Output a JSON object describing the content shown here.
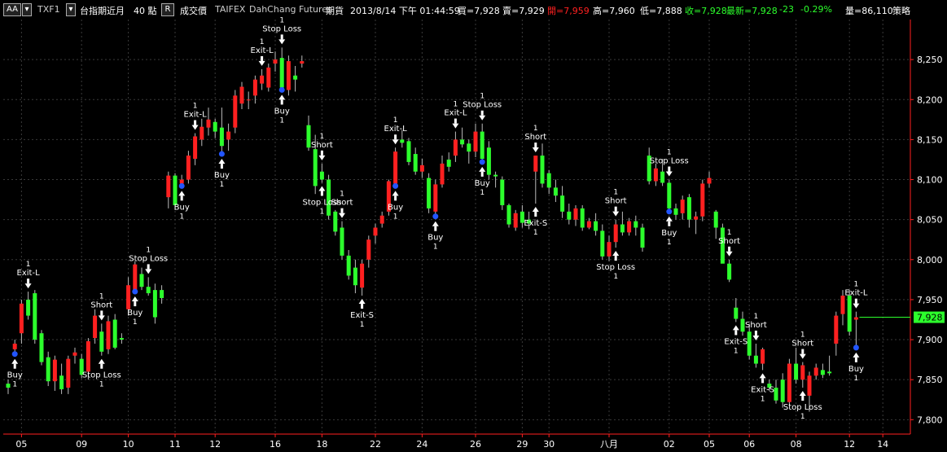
{
  "header": {
    "symbol_box": "AA",
    "symbol": "TXF1",
    "icon1": "▾",
    "name": "台指期近月",
    "interval": "40 點",
    "mode_box": "R",
    "price_type": "成交價",
    "exchange": "TAIFEX",
    "broker": "DahChang Futures",
    "kind": "期貨",
    "datetime": "2013/8/14  下午 01:44:59",
    "bid": "買=7,928",
    "ask": "賣=7,929",
    "open": "開=7,959",
    "high": "高=7,960",
    "low": "低=7,888",
    "close": "收=7,928",
    "last": "最新=7,928",
    "change": "-23",
    "pct": "-0.29%",
    "volume": "量=86,110",
    "strategy": "策略",
    "colors": {
      "up": "#ff2020",
      "down": "#2cff2c",
      "neutral": "#ffffff"
    }
  },
  "last_price_tag": "7,928",
  "chart_data": {
    "type": "candlestick",
    "y_ticks": [
      7800,
      7850,
      7900,
      7950,
      8000,
      8050,
      8100,
      8150,
      8200,
      8250
    ],
    "y_tick_labels": [
      "7,800",
      "7,850",
      "7,900",
      "7,950",
      "8,000",
      "8,050",
      "8,100",
      "8,150",
      "8,200",
      "8,250"
    ],
    "ylim": [
      7782,
      8300
    ],
    "x_tick_labels": [
      "05",
      "09",
      "10",
      "11",
      "12",
      "16",
      "18",
      "22",
      "24",
      "26",
      "29",
      "30",
      "八月",
      "02",
      "05",
      "06",
      "08",
      "12",
      "14"
    ],
    "x_tick_bar_index": [
      2,
      11,
      18,
      25,
      31,
      40,
      47,
      55,
      62,
      70,
      77,
      81,
      90,
      99,
      105,
      111,
      118,
      126,
      131
    ],
    "candles": [
      [
        7845,
        7850,
        7832,
        7840
      ],
      [
        7888,
        7900,
        7880,
        7895
      ],
      [
        7908,
        7950,
        7895,
        7945
      ],
      [
        7950,
        7960,
        7925,
        7930
      ],
      [
        7958,
        7962,
        7895,
        7900
      ],
      [
        7908,
        7912,
        7868,
        7872
      ],
      [
        7878,
        7885,
        7842,
        7848
      ],
      [
        7848,
        7880,
        7836,
        7875
      ],
      [
        7855,
        7870,
        7832,
        7838
      ],
      [
        7840,
        7880,
        7832,
        7876
      ],
      [
        7880,
        7890,
        7870,
        7884
      ],
      [
        7876,
        7882,
        7852,
        7856
      ],
      [
        7860,
        7902,
        7850,
        7898
      ],
      [
        7902,
        7938,
        7895,
        7930
      ],
      [
        7910,
        7920,
        7880,
        7885
      ],
      [
        7888,
        7930,
        7882,
        7923
      ],
      [
        7925,
        7932,
        7888,
        7890
      ],
      [
        7902,
        7908,
        7895,
        7900
      ],
      [
        7938,
        7978,
        7930,
        7968
      ],
      [
        7960,
        7998,
        7958,
        7994
      ],
      [
        7982,
        7990,
        7962,
        7966
      ],
      [
        7966,
        7978,
        7955,
        7958
      ],
      [
        7962,
        7970,
        7920,
        7928
      ],
      [
        7962,
        7968,
        7945,
        7952
      ],
      [
        8078,
        8110,
        8064,
        8105
      ],
      [
        8105,
        8108,
        8062,
        8068
      ],
      [
        8095,
        8106,
        8090,
        8100
      ],
      [
        8100,
        8136,
        8095,
        8130
      ],
      [
        8126,
        8158,
        8118,
        8154
      ],
      [
        8150,
        8176,
        8142,
        8166
      ],
      [
        8165,
        8190,
        8155,
        8175
      ],
      [
        8172,
        8176,
        8152,
        8160
      ],
      [
        8165,
        8190,
        8130,
        8142
      ],
      [
        8150,
        8170,
        8136,
        8160
      ],
      [
        8165,
        8212,
        8158,
        8205
      ],
      [
        8195,
        8222,
        8188,
        8216
      ],
      [
        8200,
        8210,
        8188,
        8200
      ],
      [
        8205,
        8230,
        8195,
        8225
      ],
      [
        8220,
        8238,
        8212,
        8230
      ],
      [
        8215,
        8245,
        8210,
        8240
      ],
      [
        8245,
        8260,
        8235,
        8250
      ],
      [
        8252,
        8265,
        8210,
        8215
      ],
      [
        8212,
        8255,
        8205,
        8248
      ],
      [
        8230,
        8242,
        8210,
        8225
      ],
      [
        8245,
        8255,
        8240,
        8248
      ],
      [
        8168,
        8180,
        8136,
        8140
      ],
      [
        8138,
        8156,
        8082,
        8092
      ],
      [
        8110,
        8120,
        8096,
        8100
      ],
      [
        8100,
        8106,
        8050,
        8055
      ],
      [
        8060,
        8062,
        8030,
        8035
      ],
      [
        8040,
        8048,
        8000,
        8005
      ],
      [
        8005,
        8012,
        7975,
        7980
      ],
      [
        7990,
        8000,
        7958,
        7968
      ],
      [
        7965,
        8000,
        7955,
        7995
      ],
      [
        8000,
        8030,
        7990,
        8025
      ],
      [
        8030,
        8045,
        8020,
        8040
      ],
      [
        8045,
        8060,
        8040,
        8055
      ],
      [
        8060,
        8100,
        8055,
        8098
      ],
      [
        8095,
        8140,
        8090,
        8135
      ],
      [
        8150,
        8162,
        8140,
        8146
      ],
      [
        8148,
        8152,
        8118,
        8122
      ],
      [
        8132,
        8140,
        8106,
        8110
      ],
      [
        8110,
        8126,
        8102,
        8118
      ],
      [
        8102,
        8108,
        8058,
        8064
      ],
      [
        8060,
        8100,
        8052,
        8094
      ],
      [
        8094,
        8130,
        8090,
        8120
      ],
      [
        8125,
        8134,
        8110,
        8116
      ],
      [
        8130,
        8160,
        8122,
        8150
      ],
      [
        8150,
        8165,
        8140,
        8144
      ],
      [
        8145,
        8150,
        8120,
        8135
      ],
      [
        8135,
        8170,
        8128,
        8160
      ],
      [
        8160,
        8170,
        8120,
        8126
      ],
      [
        8140,
        8148,
        8100,
        8106
      ],
      [
        8106,
        8110,
        8090,
        8104
      ],
      [
        8100,
        8104,
        8062,
        8068
      ],
      [
        8068,
        8070,
        8040,
        8044
      ],
      [
        8040,
        8062,
        8036,
        8058
      ],
      [
        8060,
        8068,
        8040,
        8046
      ],
      [
        8050,
        8060,
        8038,
        8045
      ],
      [
        8110,
        8130,
        8070,
        8130
      ],
      [
        8130,
        8145,
        8090,
        8095
      ],
      [
        8108,
        8112,
        8082,
        8090
      ],
      [
        8090,
        8100,
        8072,
        8080
      ],
      [
        8080,
        8092,
        8052,
        8060
      ],
      [
        8060,
        8070,
        8044,
        8050
      ],
      [
        8050,
        8068,
        8042,
        8064
      ],
      [
        8064,
        8068,
        8036,
        8040
      ],
      [
        8040,
        8052,
        8038,
        8048
      ],
      [
        8048,
        8058,
        8030,
        8036
      ],
      [
        8036,
        8044,
        8000,
        8004
      ],
      [
        8004,
        8030,
        7998,
        8022
      ],
      [
        8022,
        8050,
        8015,
        8044
      ],
      [
        8044,
        8060,
        8030,
        8034
      ],
      [
        8034,
        8052,
        8030,
        8048
      ],
      [
        8048,
        8055,
        8030,
        8040
      ],
      [
        8040,
        8045,
        8010,
        8015
      ],
      [
        8130,
        8140,
        8094,
        8098
      ],
      [
        8098,
        8120,
        8092,
        8114
      ],
      [
        8110,
        8126,
        8092,
        8096
      ],
      [
        8096,
        8100,
        8058,
        8064
      ],
      [
        8064,
        8070,
        8050,
        8056
      ],
      [
        8058,
        8080,
        8050,
        8075
      ],
      [
        8078,
        8082,
        8040,
        8050
      ],
      [
        8050,
        8060,
        8032,
        8054
      ],
      [
        8054,
        8100,
        8048,
        8095
      ],
      [
        8095,
        8110,
        8090,
        8102
      ],
      [
        8060,
        8062,
        8026,
        8040
      ],
      [
        8040,
        8045,
        8000,
        7995
      ],
      [
        7995,
        8000,
        7972,
        7975
      ],
      [
        7940,
        7952,
        7922,
        7926
      ],
      [
        7926,
        7935,
        7905,
        7910
      ],
      [
        7910,
        7920,
        7875,
        7880
      ],
      [
        7880,
        7895,
        7865,
        7870
      ],
      [
        7870,
        7890,
        7862,
        7888
      ],
      [
        7845,
        7850,
        7836,
        7840
      ],
      [
        7840,
        7850,
        7820,
        7824
      ],
      [
        7850,
        7858,
        7815,
        7822
      ],
      [
        7822,
        7876,
        7818,
        7870
      ],
      [
        7870,
        7890,
        7845,
        7850
      ],
      [
        7850,
        7872,
        7840,
        7868
      ],
      [
        7830,
        7860,
        7810,
        7855
      ],
      [
        7855,
        7870,
        7850,
        7865
      ],
      [
        7862,
        7870,
        7852,
        7856
      ],
      [
        7860,
        7880,
        7855,
        7858
      ],
      [
        7895,
        7935,
        7880,
        7930
      ],
      [
        7932,
        7962,
        7918,
        7955
      ],
      [
        7955,
        7962,
        7905,
        7910
      ],
      [
        7925,
        7935,
        7888,
        7928
      ]
    ],
    "annotations": [
      {
        "bar": 1,
        "text": "Buy",
        "qty": "1",
        "pos": "below",
        "dot": "#2255ff"
      },
      {
        "bar": 3,
        "text": "Exit-L",
        "qty": "1",
        "pos": "above"
      },
      {
        "bar": 14,
        "text": "Short",
        "qty": "1",
        "pos": "above"
      },
      {
        "bar": 14,
        "text": "Stop Loss",
        "qty": "1",
        "pos": "below"
      },
      {
        "bar": 19,
        "text": "Buy",
        "qty": "1",
        "pos": "below",
        "dot": "#2255ff"
      },
      {
        "bar": 21,
        "text": "Stop Loss",
        "qty": "1",
        "pos": "above"
      },
      {
        "bar": 26,
        "text": "Buy",
        "qty": "1",
        "pos": "below",
        "dot": "#2255ff"
      },
      {
        "bar": 28,
        "text": "Exit-L",
        "qty": "1",
        "pos": "above"
      },
      {
        "bar": 32,
        "text": "Buy",
        "qty": "1",
        "pos": "below",
        "dot": "#2255ff"
      },
      {
        "bar": 38,
        "text": "Exit-L",
        "qty": "1",
        "pos": "above"
      },
      {
        "bar": 41,
        "text": "Stop Loss",
        "qty": "1",
        "pos": "above"
      },
      {
        "bar": 41,
        "text": "Buy",
        "qty": "1",
        "pos": "below",
        "dot": "#2255ff"
      },
      {
        "bar": 47,
        "text": "Short",
        "qty": "1",
        "pos": "above"
      },
      {
        "bar": 47,
        "text": "Stop Loss",
        "qty": "1",
        "pos": "below"
      },
      {
        "bar": 50,
        "text": "Short",
        "qty": "1",
        "pos": "above"
      },
      {
        "bar": 53,
        "text": "Exit-S",
        "qty": "1",
        "pos": "below"
      },
      {
        "bar": 58,
        "text": "Exit-L",
        "qty": "1",
        "pos": "above"
      },
      {
        "bar": 58,
        "text": "Buy",
        "qty": "1",
        "pos": "below",
        "dot": "#2255ff"
      },
      {
        "bar": 64,
        "text": "Buy",
        "qty": "1",
        "pos": "below",
        "dot": "#2255ff"
      },
      {
        "bar": 67,
        "text": "Exit-L",
        "qty": "1",
        "pos": "above"
      },
      {
        "bar": 71,
        "text": "Stop Loss",
        "qty": "1",
        "pos": "above"
      },
      {
        "bar": 71,
        "text": "Buy",
        "qty": "1",
        "pos": "below",
        "dot": "#2255ff"
      },
      {
        "bar": 79,
        "text": "Short",
        "qty": "1",
        "pos": "above"
      },
      {
        "bar": 79,
        "text": "Exit-S",
        "qty": "1",
        "pos": "below"
      },
      {
        "bar": 91,
        "text": "Short",
        "qty": "1",
        "pos": "above"
      },
      {
        "bar": 91,
        "text": "Stop Loss",
        "qty": "1",
        "pos": "below"
      },
      {
        "bar": 99,
        "text": "Stop Loss",
        "qty": "1",
        "pos": "above"
      },
      {
        "bar": 99,
        "text": "Buy",
        "qty": "1",
        "pos": "below",
        "dot": "#2255ff"
      },
      {
        "bar": 108,
        "text": "Short",
        "qty": "1",
        "pos": "above"
      },
      {
        "bar": 109,
        "text": "Exit-S",
        "qty": "1",
        "pos": "below"
      },
      {
        "bar": 112,
        "text": "Short",
        "qty": "1",
        "pos": "above"
      },
      {
        "bar": 113,
        "text": "Exit-S",
        "qty": "1",
        "pos": "below"
      },
      {
        "bar": 119,
        "text": "Short",
        "qty": "1",
        "pos": "above"
      },
      {
        "bar": 119,
        "text": "Stop Loss",
        "qty": "1",
        "pos": "below"
      },
      {
        "bar": 127,
        "text": "Exit-L",
        "qty": "1",
        "pos": "above"
      },
      {
        "bar": 127,
        "text": "Buy",
        "qty": "1",
        "pos": "below",
        "dot": "#2255ff"
      }
    ]
  }
}
